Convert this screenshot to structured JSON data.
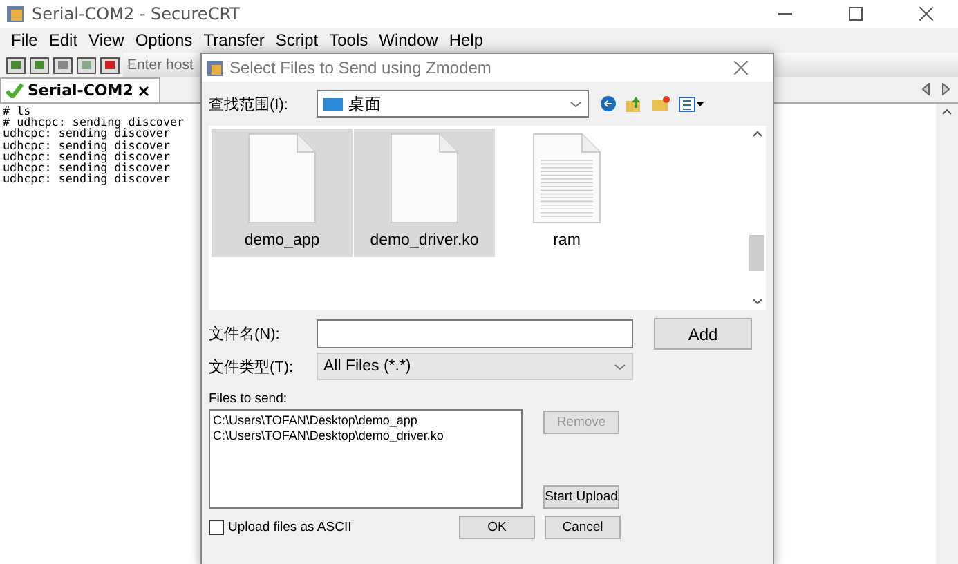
{
  "window": {
    "title": "Serial-COM2 - SecureCRT"
  },
  "menu": [
    "File",
    "Edit",
    "View",
    "Options",
    "Transfer",
    "Script",
    "Tools",
    "Window",
    "Help"
  ],
  "toolbar": {
    "host_placeholder": "Enter host"
  },
  "tabs": [
    {
      "label": "Serial-COM2",
      "selected": true,
      "connected": true
    }
  ],
  "terminal": {
    "lines": [
      "# ls",
      "# udhcpc: sending discover",
      "udhcpc: sending discover",
      "udhcpc: sending discover",
      "udhcpc: sending discover",
      "udhcpc: sending discover",
      "udhcpc: sending discover"
    ]
  },
  "dialog": {
    "title": "Select Files to Send using Zmodem",
    "look_in": {
      "label": "查找范围(I):",
      "value": "桌面"
    },
    "files": [
      {
        "name": "demo_app",
        "kind": "blank",
        "selected": true
      },
      {
        "name": "demo_driver.ko",
        "kind": "blank",
        "selected": true
      },
      {
        "name": "ram",
        "kind": "text",
        "selected": false
      }
    ],
    "file_name": {
      "label": "文件名(N):"
    },
    "file_type": {
      "label": "文件类型(T):",
      "value": "All Files (*.*)"
    },
    "files_to_send": {
      "label": "Files to send:",
      "items": [
        "C:\\Users\\TOFAN\\Desktop\\demo_app",
        "C:\\Users\\TOFAN\\Desktop\\demo_driver.ko"
      ]
    },
    "buttons": {
      "add": {
        "label": "Add",
        "disabled": false
      },
      "remove": {
        "label": "Remove",
        "disabled": true
      },
      "start_upload": {
        "label": "Start Upload",
        "disabled": false
      },
      "ok": {
        "label": "OK",
        "disabled": false
      },
      "cancel": {
        "label": "Cancel",
        "disabled": false
      }
    },
    "ascii": {
      "label": "Upload files as ASCII",
      "checked": false
    }
  }
}
